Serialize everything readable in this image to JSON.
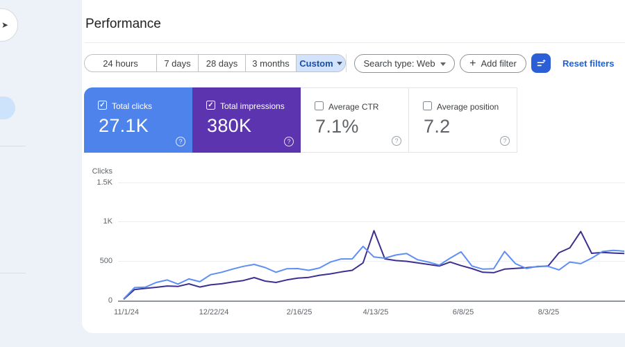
{
  "app": {
    "title": "Performance"
  },
  "icons": {
    "caret_glyph": "",
    "help_glyph": "?",
    "check_glyph": "✓",
    "property_glyph": "➤",
    "plus_glyph": "+"
  },
  "filters": {
    "date_ranges": [
      "24 hours",
      "7 days",
      "28 days",
      "3 months",
      "Custom"
    ],
    "selected_range": "Custom",
    "search_type_label": "Search type: Web",
    "add_filter_label": "Add filter",
    "reset_label": "Reset filters"
  },
  "metric_cards": [
    {
      "label": "Total clicks",
      "value": "27.1K",
      "checked": true,
      "checkbox_glyph": "✓",
      "bg": "#4f83ec",
      "text": "#ffffff"
    },
    {
      "label": "Total impressions",
      "value": "380K",
      "checked": true,
      "checkbox_glyph": "✓",
      "bg": "#5c34af",
      "text": "#ffffff"
    },
    {
      "label": "Average CTR",
      "value": "7.1%",
      "checked": false,
      "checkbox_glyph": "",
      "bg": "#ffffff",
      "text": ""
    },
    {
      "label": "Average position",
      "value": "7.2",
      "checked": false,
      "checkbox_glyph": "",
      "bg": "#ffffff",
      "text": ""
    }
  ],
  "chart_data": {
    "type": "line",
    "ylabel": "Clicks",
    "ylim": [
      0,
      1500
    ],
    "y_tick_labels": [
      "1.5K",
      "1K",
      "500",
      "0"
    ],
    "x_tick_labels": [
      "11/1/24",
      "12/22/24",
      "2/16/25",
      "4/13/25",
      "6/8/25",
      "8/3/25"
    ],
    "x_interval": "weekly points starting 11/1/24",
    "grid": true,
    "legend": "none (series toggled via metric cards)",
    "series": [
      {
        "name": "Total clicks",
        "color": "#5e8ef4",
        "values": [
          20,
          165,
          170,
          230,
          262,
          210,
          275,
          240,
          330,
          360,
          400,
          435,
          460,
          420,
          360,
          405,
          407,
          385,
          415,
          490,
          530,
          530,
          690,
          555,
          540,
          580,
          600,
          520,
          490,
          450,
          540,
          620,
          440,
          400,
          405,
          625,
          470,
          408,
          435,
          435,
          390,
          490,
          470,
          540,
          625,
          640,
          628
        ]
      },
      {
        "name": "Total impressions",
        "color": "#3d2f8f",
        "scale_note": "impressions line as drawn against the visible clicks axis",
        "values": [
          15,
          140,
          155,
          168,
          185,
          180,
          212,
          172,
          200,
          213,
          235,
          255,
          292,
          248,
          230,
          263,
          285,
          295,
          322,
          340,
          365,
          385,
          480,
          890,
          531,
          510,
          500,
          480,
          460,
          440,
          490,
          445,
          407,
          360,
          355,
          400,
          410,
          418,
          432,
          440,
          610,
          672,
          880,
          602,
          612,
          605,
          600
        ]
      }
    ]
  },
  "colors": {
    "page_bg": "#edf1f8",
    "card_bg": "#ffffff",
    "selected_chip_bg": "#d3e3fd",
    "selected_chip_text": "#174ea6",
    "filter_button_bg": "#2c5ed6",
    "reset_link": "#1d62d5",
    "clicks_card": "#4f83ec",
    "impressions_card": "#5c34af",
    "clicks_line": "#5e8ef4",
    "impressions_line": "#3d2f8f"
  }
}
